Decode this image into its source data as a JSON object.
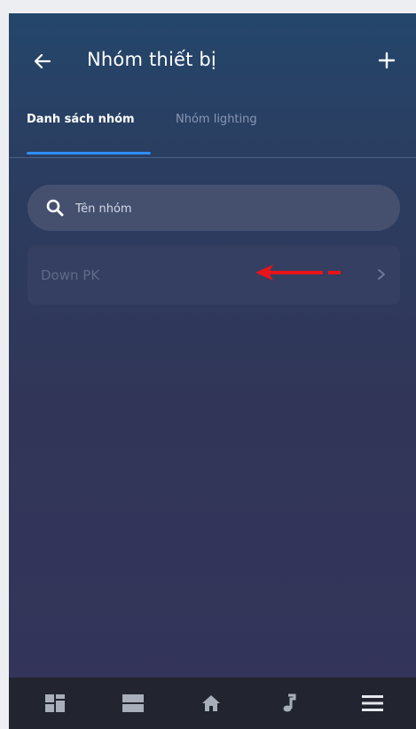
{
  "header": {
    "title": "Nhóm thiết bị",
    "back_icon": "arrow-left-icon",
    "add_icon": "plus-icon"
  },
  "tabs": [
    {
      "label": "Danh sách nhóm",
      "active": true
    },
    {
      "label": "Nhóm lighting",
      "active": false
    }
  ],
  "search": {
    "placeholder": "Tên nhóm",
    "value": "",
    "icon": "search-icon"
  },
  "groups": [
    {
      "name": "Down PK",
      "icon": "chevron-right-icon"
    }
  ],
  "annotation": {
    "icon": "red-arrow-left-icon",
    "color": "#e8141b"
  },
  "bottom_nav": [
    {
      "icon": "dashboard-grid-icon"
    },
    {
      "icon": "rooms-list-icon"
    },
    {
      "icon": "home-icon"
    },
    {
      "icon": "music-note-icon"
    },
    {
      "icon": "menu-icon"
    }
  ],
  "colors": {
    "accent": "#2f8dff",
    "background_top": "#24466b",
    "background_bottom": "#34345a",
    "nav_background": "#22252f"
  }
}
